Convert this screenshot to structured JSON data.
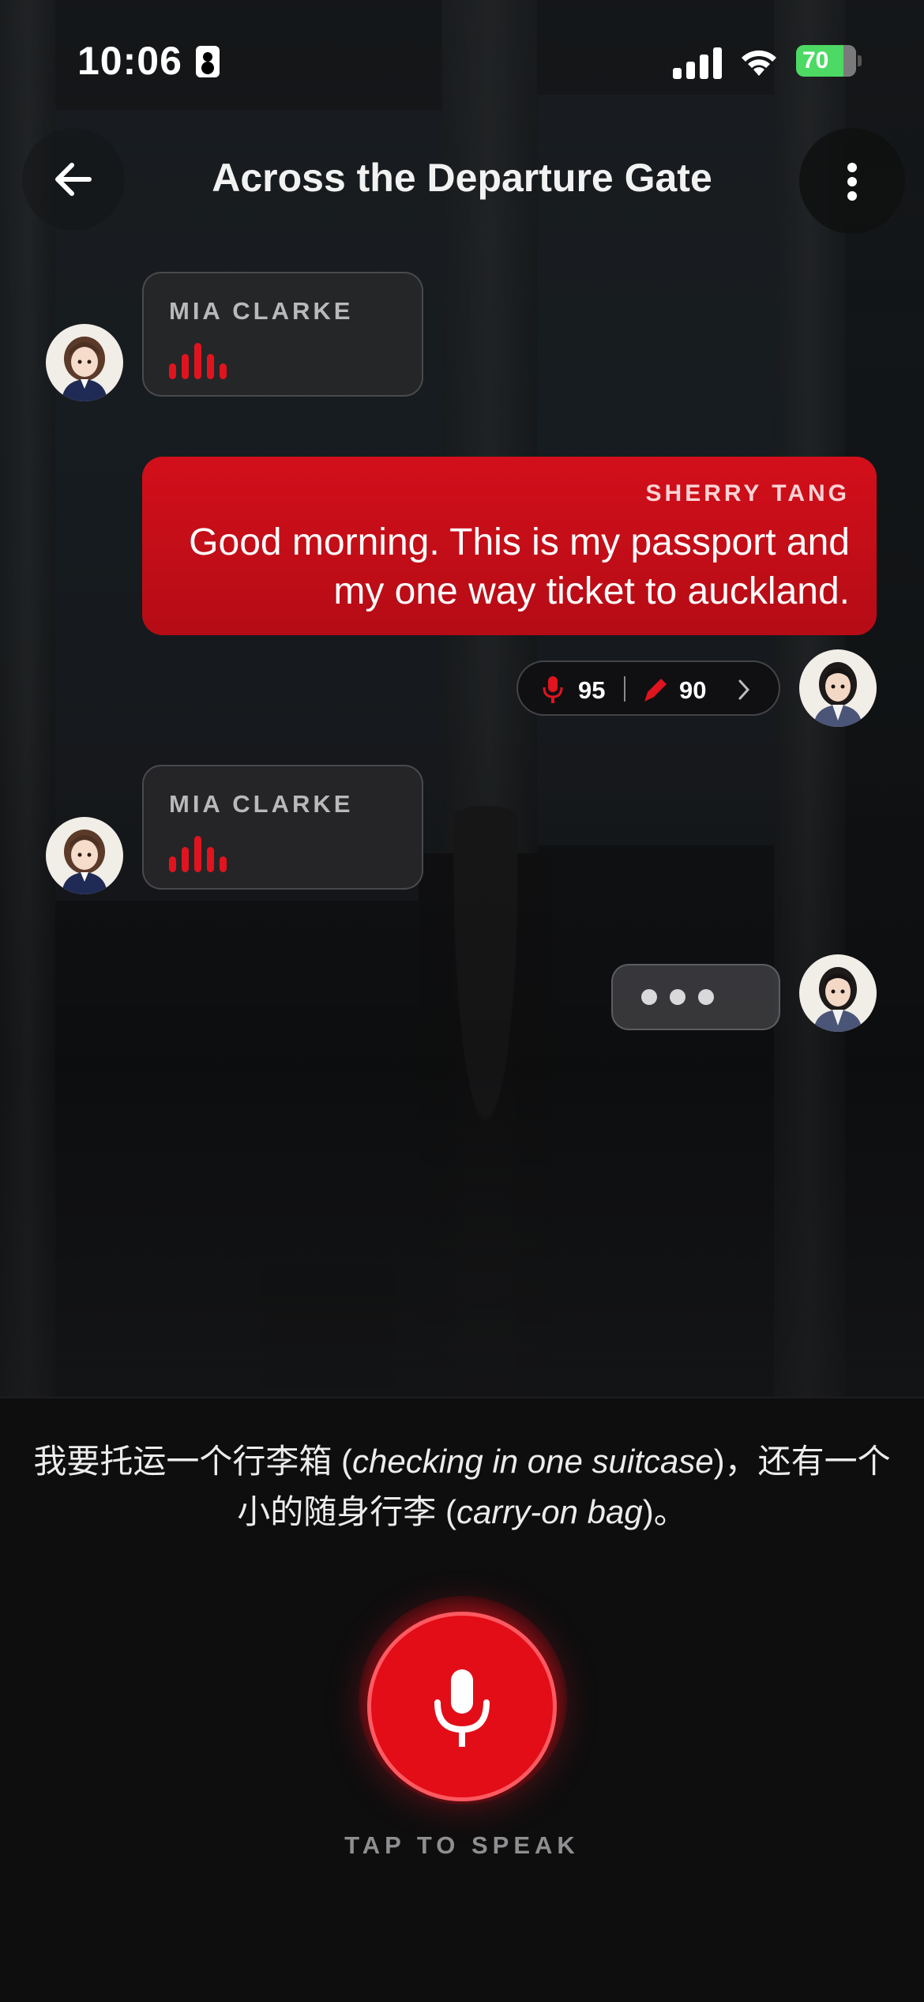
{
  "status_bar": {
    "time": "10:06",
    "battery_level": "70"
  },
  "header": {
    "title": "Across the Departure Gate"
  },
  "chat": {
    "messages": [
      {
        "speaker": "MIA CLARKE",
        "kind": "audio"
      },
      {
        "speaker": "SHERRY TANG",
        "kind": "text",
        "text": "Good morning. This is my passport and my one way ticket to auckland."
      },
      {
        "speaker": "MIA CLARKE",
        "kind": "audio"
      }
    ],
    "scores": {
      "pronunciation": "95",
      "grammar": "90"
    }
  },
  "prompt": {
    "part1": "我要托运一个行李箱 (",
    "term1": "checking in one suitcase",
    "part2": ")，还有一个小的随身行李 (",
    "term2": "carry-on bag",
    "part3": ")。"
  },
  "mic": {
    "label": "TAP TO SPEAK"
  },
  "colors": {
    "accent": "#e30d17",
    "user_bubble": "#c80f19",
    "background": "#0e0e0f"
  }
}
